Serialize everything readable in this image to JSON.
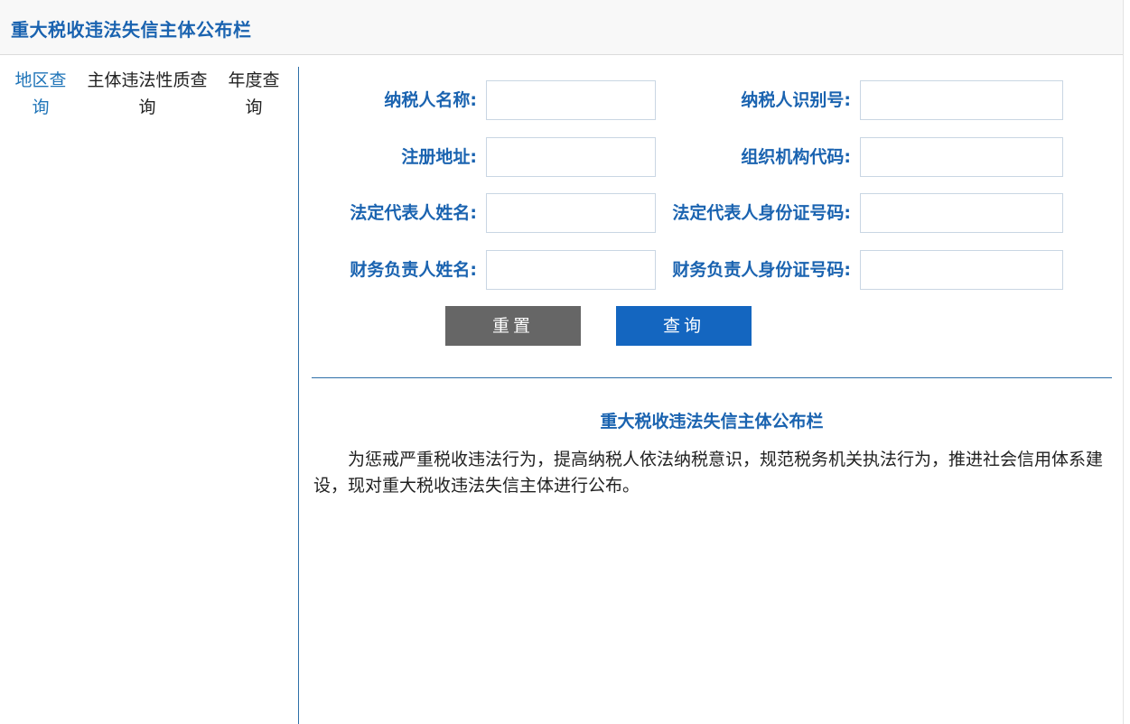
{
  "header": {
    "title": "重大税收违法失信主体公布栏"
  },
  "nav": {
    "tabs": [
      {
        "label": "地区查询",
        "active": true
      },
      {
        "label": "主体违法性质查询",
        "active": false
      },
      {
        "label": "年度查询",
        "active": false
      }
    ]
  },
  "form": {
    "fields": [
      {
        "label": "纳税人名称:",
        "value": "",
        "placeholder": ""
      },
      {
        "label": "纳税人识别号:",
        "value": "",
        "placeholder": ""
      },
      {
        "label": "注册地址:",
        "value": "",
        "placeholder": ""
      },
      {
        "label": "组织机构代码:",
        "value": "",
        "placeholder": ""
      },
      {
        "label": "法定代表人姓名:",
        "value": "",
        "placeholder": ""
      },
      {
        "label": "法定代表人身份证号码:",
        "value": "",
        "placeholder": ""
      },
      {
        "label": "财务负责人姓名:",
        "value": "",
        "placeholder": ""
      },
      {
        "label": "财务负责人身份证号码:",
        "value": "",
        "placeholder": ""
      }
    ],
    "reset_label": "重置",
    "search_label": "查询"
  },
  "notice": {
    "title": "重大税收违法失信主体公布栏",
    "body": "为惩戒严重税收违法行为，提高纳税人依法纳税意识，规范税务机关执法行为，推进社会信用体系建设，现对重大税收违法失信主体进行公布。"
  },
  "colors": {
    "accent": "#1a63b0",
    "button_primary": "#1466c0",
    "button_secondary": "#666666",
    "divider": "#2e6fa8"
  }
}
